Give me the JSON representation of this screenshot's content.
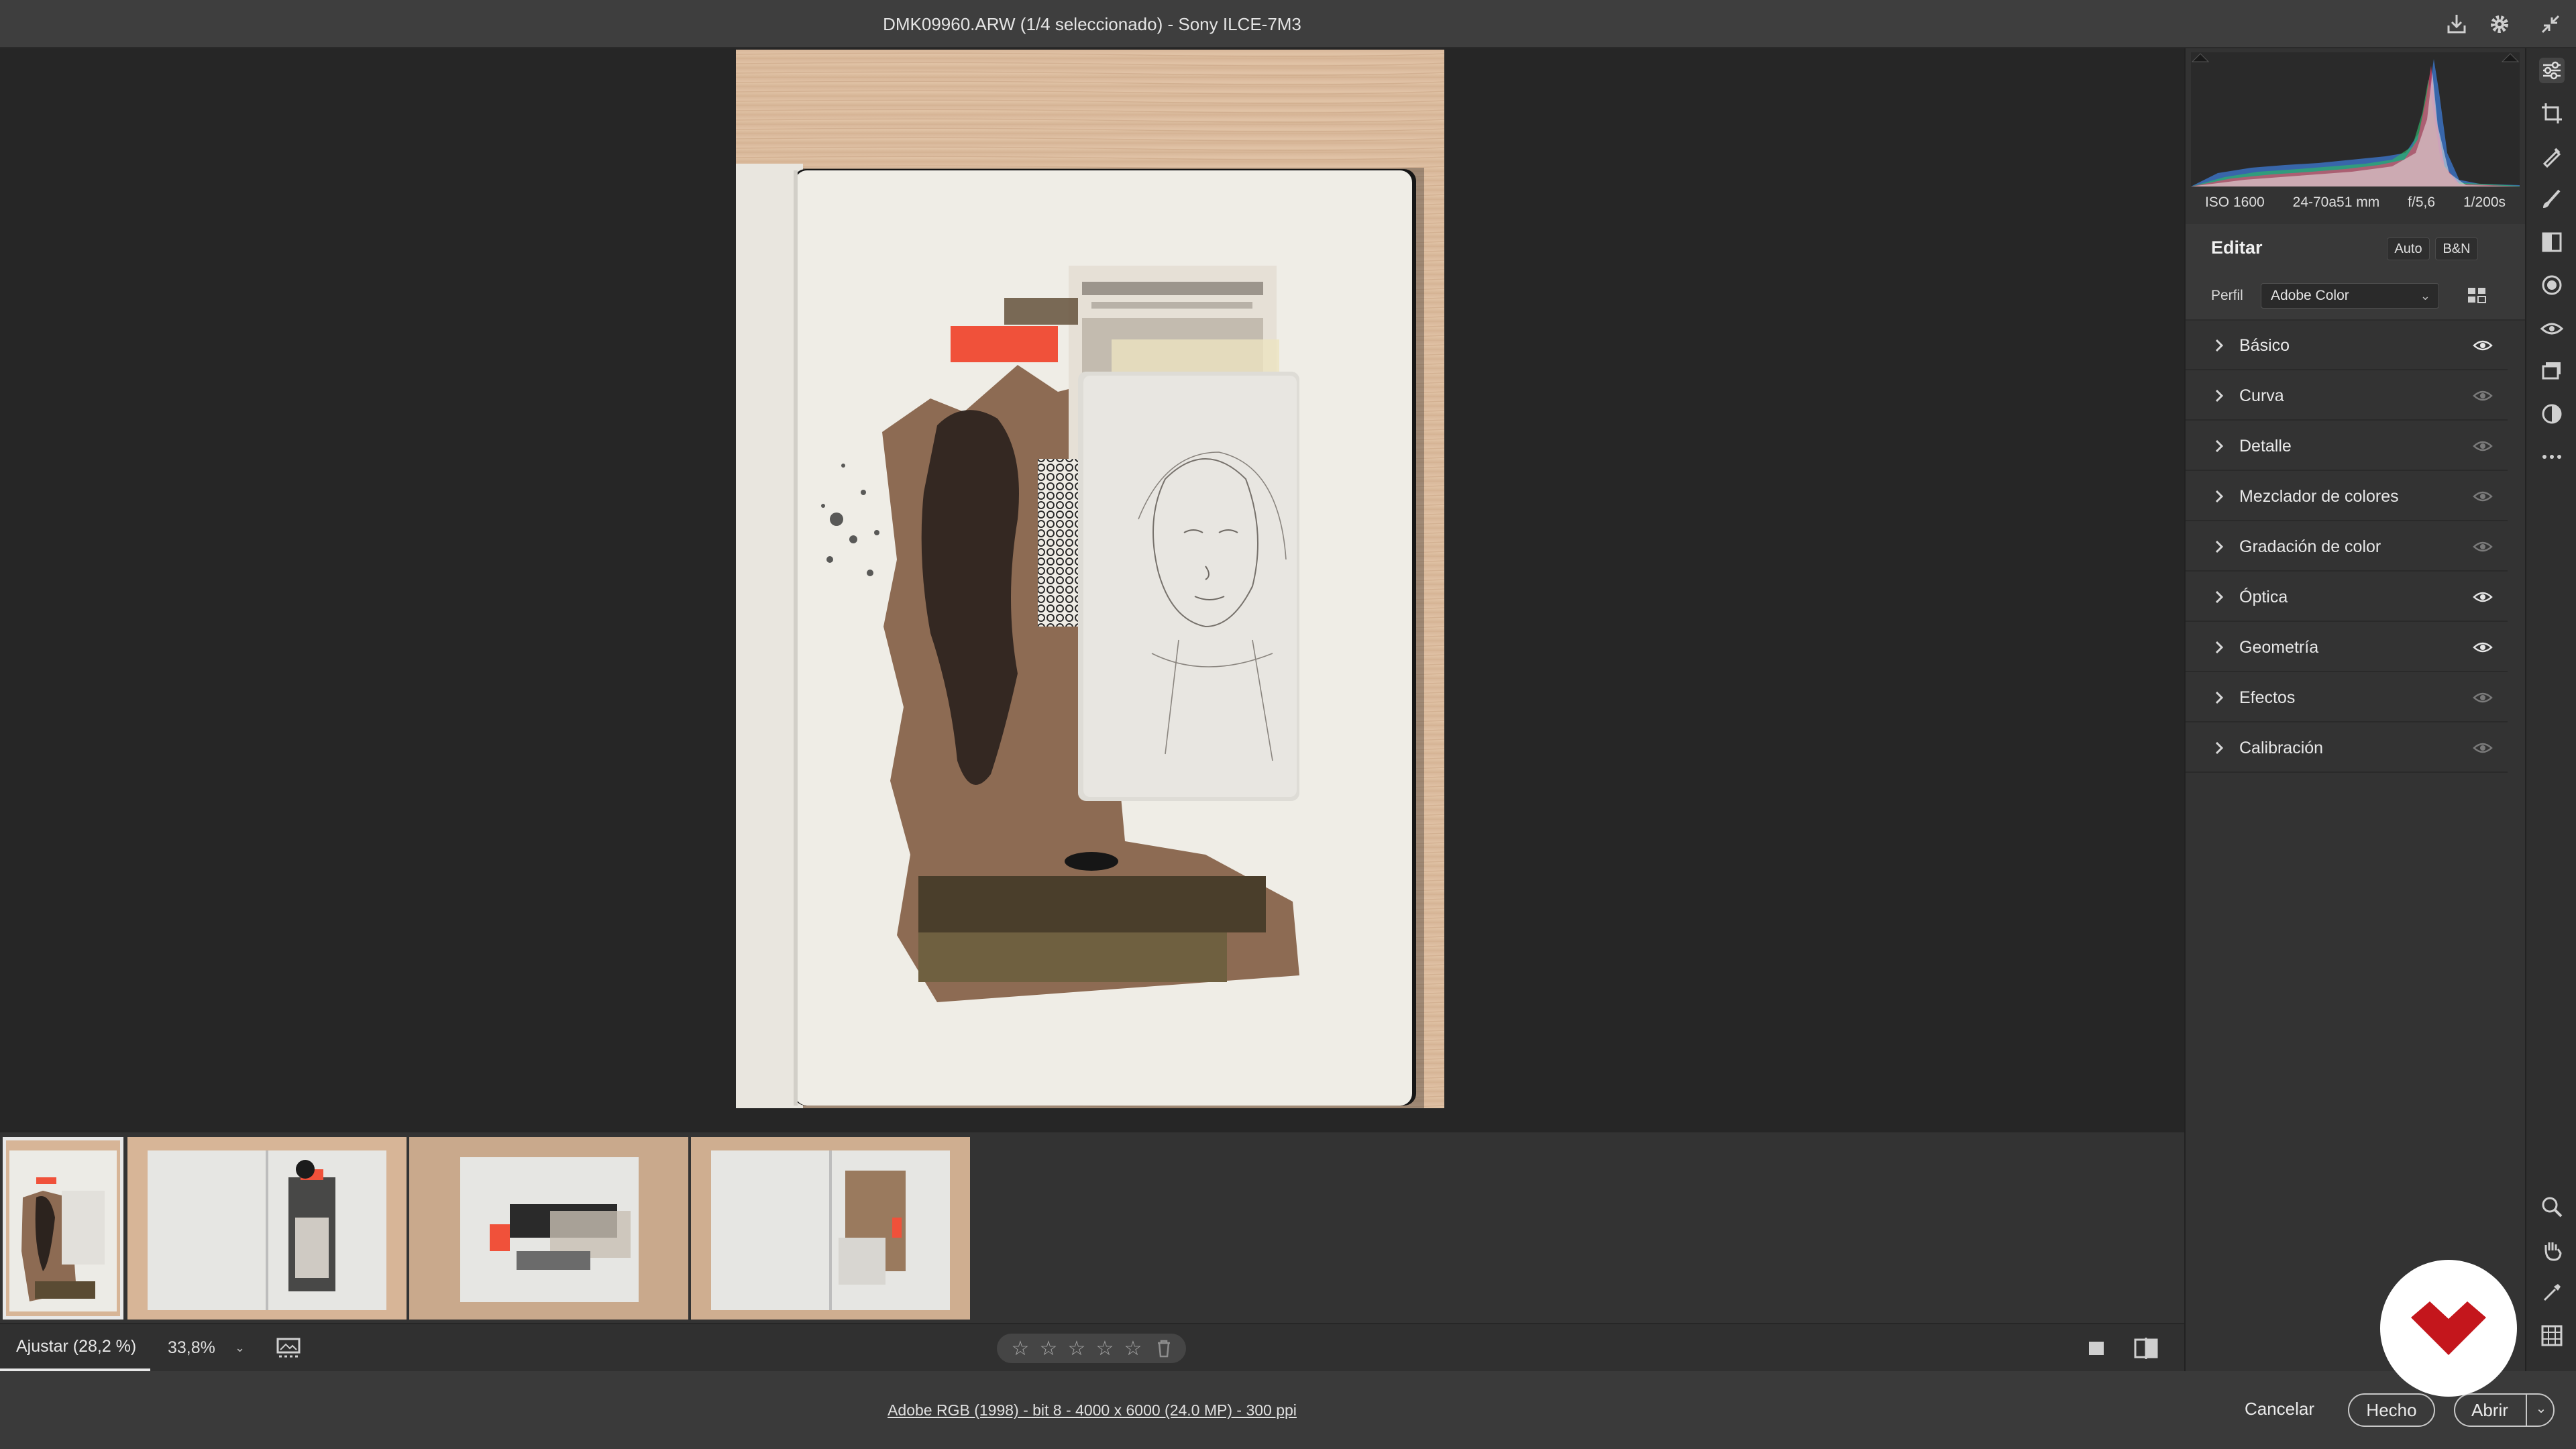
{
  "window": {
    "title": "DMK09960.ARW (1/4 seleccionado) -  Sony ILCE-7M3",
    "icons": [
      "save-icon",
      "settings-gear-icon",
      "collapse-icon"
    ]
  },
  "filmstrip": {
    "thumbnails": [
      {
        "label": "collage-sketchbook",
        "selected": true
      },
      {
        "label": "sketchbook-spread-2",
        "selected": false
      },
      {
        "label": "sketchbook-spread-3",
        "selected": false
      },
      {
        "label": "sketchbook-spread-4",
        "selected": false
      }
    ]
  },
  "toolbar": {
    "zoom_fit": "Ajustar (28,2 %)",
    "zoom_value": "33,8%",
    "rating_stars": [
      "☆",
      "☆",
      "☆",
      "☆",
      "☆"
    ],
    "rating_value": 0
  },
  "statusbar": {
    "file_info": "Adobe RGB (1998) - bit 8 - 4000 x 6000 (24.0 MP) - 300 ppi",
    "cancel": "Cancelar",
    "done": "Hecho",
    "open": "Abrir"
  },
  "panel": {
    "exif": {
      "iso": "ISO 1600",
      "lens": "24-70a51 mm",
      "aperture": "f/5,6",
      "shutter": "1/200s"
    },
    "edit_title": "Editar",
    "auto": "Auto",
    "bw": "B&N",
    "profile_label": "Perfil",
    "profile_value": "Adobe Color",
    "sections": [
      {
        "label": "Básico",
        "visible_strong": true
      },
      {
        "label": "Curva",
        "visible_strong": false
      },
      {
        "label": "Detalle",
        "visible_strong": false
      },
      {
        "label": "Mezclador de colores",
        "visible_strong": false
      },
      {
        "label": "Gradación de color",
        "visible_strong": false
      },
      {
        "label": "Óptica",
        "visible_strong": true
      },
      {
        "label": "Geometría",
        "visible_strong": true
      },
      {
        "label": "Efectos",
        "visible_strong": false
      },
      {
        "label": "Calibración",
        "visible_strong": false
      }
    ]
  },
  "rail": {
    "top_tools": [
      "edit-sliders-icon",
      "crop-icon",
      "healing-icon",
      "brush-icon",
      "gradient-icon",
      "radial-icon",
      "redeye-icon",
      "snapshots-icon",
      "presets-icon",
      "more-icon"
    ],
    "bottom_tools": [
      "zoom-icon",
      "hand-icon",
      "eyedropper-icon",
      "grid-icon"
    ]
  },
  "colors": {
    "accent_logo": "#c4161c",
    "panel_bg": "#333333",
    "canvas_bg": "#262626"
  }
}
